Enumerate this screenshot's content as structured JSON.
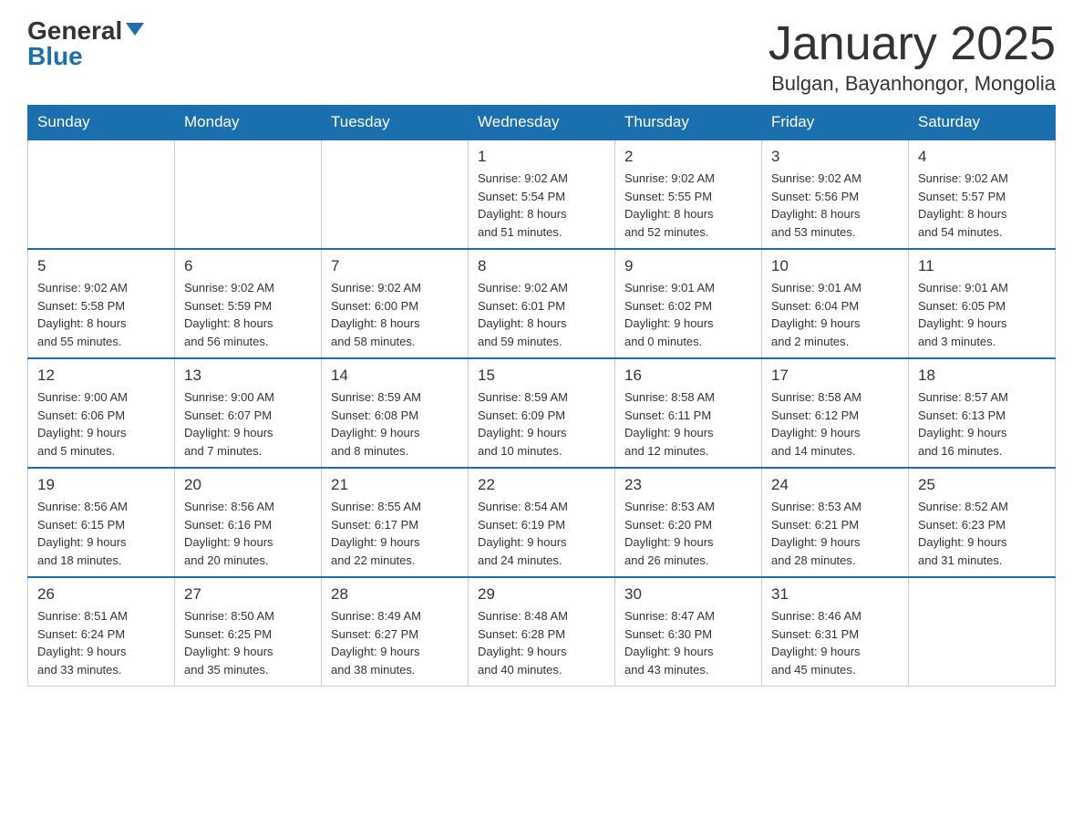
{
  "header": {
    "logo_general": "General",
    "logo_blue": "Blue",
    "month_title": "January 2025",
    "location": "Bulgan, Bayanhongor, Mongolia"
  },
  "days_of_week": [
    "Sunday",
    "Monday",
    "Tuesday",
    "Wednesday",
    "Thursday",
    "Friday",
    "Saturday"
  ],
  "weeks": [
    [
      {
        "day": "",
        "info": ""
      },
      {
        "day": "",
        "info": ""
      },
      {
        "day": "",
        "info": ""
      },
      {
        "day": "1",
        "info": "Sunrise: 9:02 AM\nSunset: 5:54 PM\nDaylight: 8 hours\nand 51 minutes."
      },
      {
        "day": "2",
        "info": "Sunrise: 9:02 AM\nSunset: 5:55 PM\nDaylight: 8 hours\nand 52 minutes."
      },
      {
        "day": "3",
        "info": "Sunrise: 9:02 AM\nSunset: 5:56 PM\nDaylight: 8 hours\nand 53 minutes."
      },
      {
        "day": "4",
        "info": "Sunrise: 9:02 AM\nSunset: 5:57 PM\nDaylight: 8 hours\nand 54 minutes."
      }
    ],
    [
      {
        "day": "5",
        "info": "Sunrise: 9:02 AM\nSunset: 5:58 PM\nDaylight: 8 hours\nand 55 minutes."
      },
      {
        "day": "6",
        "info": "Sunrise: 9:02 AM\nSunset: 5:59 PM\nDaylight: 8 hours\nand 56 minutes."
      },
      {
        "day": "7",
        "info": "Sunrise: 9:02 AM\nSunset: 6:00 PM\nDaylight: 8 hours\nand 58 minutes."
      },
      {
        "day": "8",
        "info": "Sunrise: 9:02 AM\nSunset: 6:01 PM\nDaylight: 8 hours\nand 59 minutes."
      },
      {
        "day": "9",
        "info": "Sunrise: 9:01 AM\nSunset: 6:02 PM\nDaylight: 9 hours\nand 0 minutes."
      },
      {
        "day": "10",
        "info": "Sunrise: 9:01 AM\nSunset: 6:04 PM\nDaylight: 9 hours\nand 2 minutes."
      },
      {
        "day": "11",
        "info": "Sunrise: 9:01 AM\nSunset: 6:05 PM\nDaylight: 9 hours\nand 3 minutes."
      }
    ],
    [
      {
        "day": "12",
        "info": "Sunrise: 9:00 AM\nSunset: 6:06 PM\nDaylight: 9 hours\nand 5 minutes."
      },
      {
        "day": "13",
        "info": "Sunrise: 9:00 AM\nSunset: 6:07 PM\nDaylight: 9 hours\nand 7 minutes."
      },
      {
        "day": "14",
        "info": "Sunrise: 8:59 AM\nSunset: 6:08 PM\nDaylight: 9 hours\nand 8 minutes."
      },
      {
        "day": "15",
        "info": "Sunrise: 8:59 AM\nSunset: 6:09 PM\nDaylight: 9 hours\nand 10 minutes."
      },
      {
        "day": "16",
        "info": "Sunrise: 8:58 AM\nSunset: 6:11 PM\nDaylight: 9 hours\nand 12 minutes."
      },
      {
        "day": "17",
        "info": "Sunrise: 8:58 AM\nSunset: 6:12 PM\nDaylight: 9 hours\nand 14 minutes."
      },
      {
        "day": "18",
        "info": "Sunrise: 8:57 AM\nSunset: 6:13 PM\nDaylight: 9 hours\nand 16 minutes."
      }
    ],
    [
      {
        "day": "19",
        "info": "Sunrise: 8:56 AM\nSunset: 6:15 PM\nDaylight: 9 hours\nand 18 minutes."
      },
      {
        "day": "20",
        "info": "Sunrise: 8:56 AM\nSunset: 6:16 PM\nDaylight: 9 hours\nand 20 minutes."
      },
      {
        "day": "21",
        "info": "Sunrise: 8:55 AM\nSunset: 6:17 PM\nDaylight: 9 hours\nand 22 minutes."
      },
      {
        "day": "22",
        "info": "Sunrise: 8:54 AM\nSunset: 6:19 PM\nDaylight: 9 hours\nand 24 minutes."
      },
      {
        "day": "23",
        "info": "Sunrise: 8:53 AM\nSunset: 6:20 PM\nDaylight: 9 hours\nand 26 minutes."
      },
      {
        "day": "24",
        "info": "Sunrise: 8:53 AM\nSunset: 6:21 PM\nDaylight: 9 hours\nand 28 minutes."
      },
      {
        "day": "25",
        "info": "Sunrise: 8:52 AM\nSunset: 6:23 PM\nDaylight: 9 hours\nand 31 minutes."
      }
    ],
    [
      {
        "day": "26",
        "info": "Sunrise: 8:51 AM\nSunset: 6:24 PM\nDaylight: 9 hours\nand 33 minutes."
      },
      {
        "day": "27",
        "info": "Sunrise: 8:50 AM\nSunset: 6:25 PM\nDaylight: 9 hours\nand 35 minutes."
      },
      {
        "day": "28",
        "info": "Sunrise: 8:49 AM\nSunset: 6:27 PM\nDaylight: 9 hours\nand 38 minutes."
      },
      {
        "day": "29",
        "info": "Sunrise: 8:48 AM\nSunset: 6:28 PM\nDaylight: 9 hours\nand 40 minutes."
      },
      {
        "day": "30",
        "info": "Sunrise: 8:47 AM\nSunset: 6:30 PM\nDaylight: 9 hours\nand 43 minutes."
      },
      {
        "day": "31",
        "info": "Sunrise: 8:46 AM\nSunset: 6:31 PM\nDaylight: 9 hours\nand 45 minutes."
      },
      {
        "day": "",
        "info": ""
      }
    ]
  ]
}
